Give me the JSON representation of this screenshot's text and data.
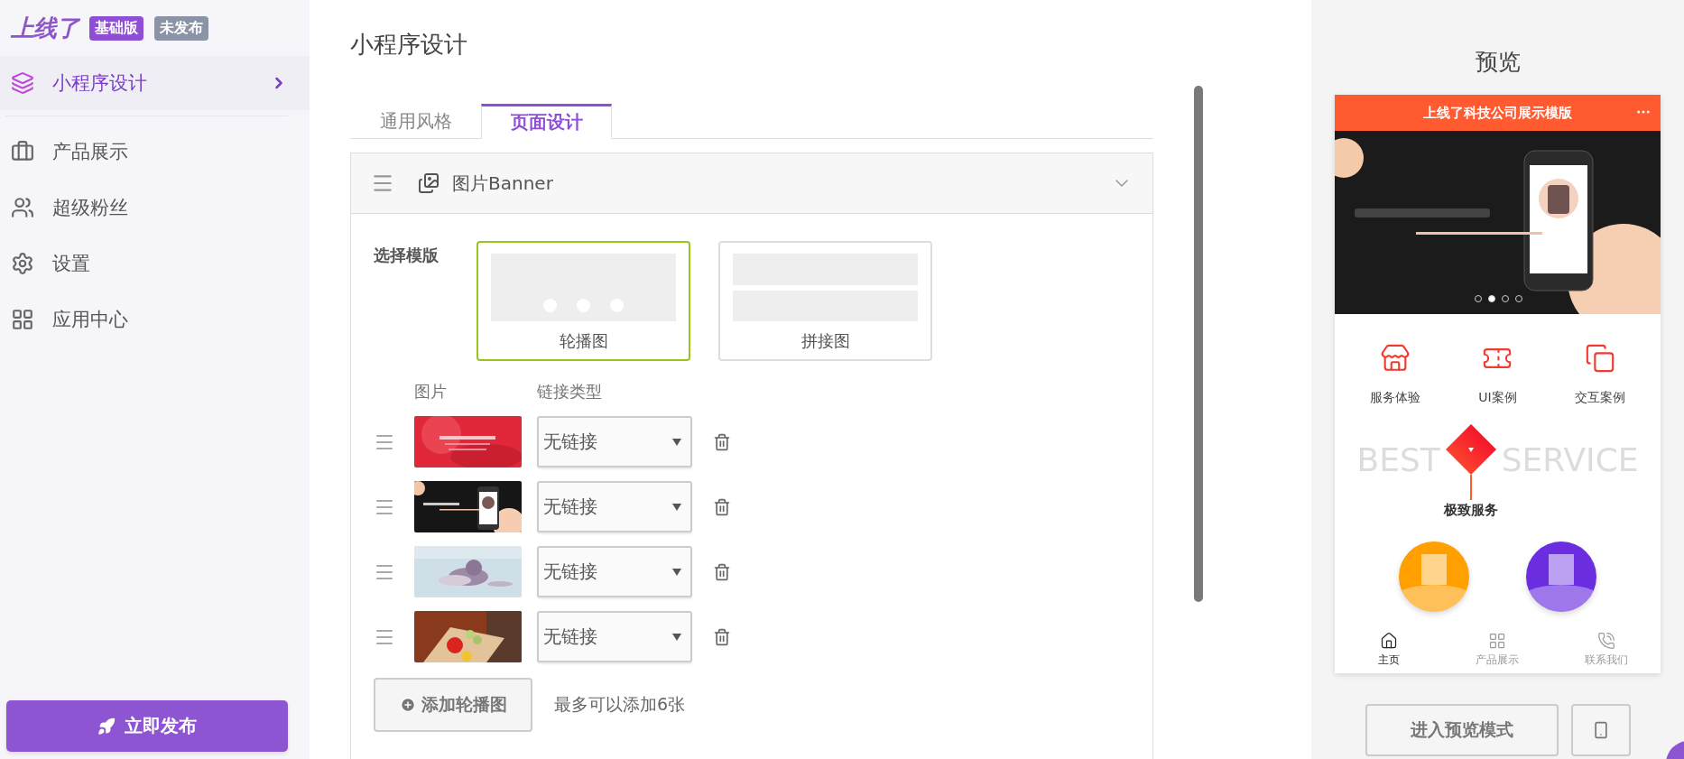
{
  "sidebar": {
    "logo": "上线了",
    "badges": [
      {
        "label": "基础版",
        "kind": "plan"
      },
      {
        "label": "未发布",
        "kind": "status"
      }
    ],
    "items": [
      {
        "label": "小程序设计",
        "kind": "layers",
        "selected": true
      },
      {
        "label": "产品展示",
        "kind": "briefcase",
        "selected": false
      },
      {
        "label": "超级粉丝",
        "kind": "users",
        "selected": false
      },
      {
        "label": "设置",
        "kind": "settings",
        "selected": false
      },
      {
        "label": "应用中心",
        "kind": "apps",
        "selected": false
      }
    ],
    "publish_button": "立即发布"
  },
  "main": {
    "title": "小程序设计",
    "tabs": [
      {
        "label": "通用风格",
        "selected": false
      },
      {
        "label": "页面设计",
        "selected": true
      }
    ],
    "module": {
      "title": "图片Banner",
      "expanded": true,
      "template_label": "选择模版",
      "templates": [
        {
          "label": "轮播图",
          "kind": "carousel",
          "selected": true
        },
        {
          "label": "拼接图",
          "kind": "collage",
          "selected": false
        }
      ],
      "columns": [
        "图片",
        "链接类型"
      ],
      "rows": [
        {
          "link_type": "无链接"
        },
        {
          "link_type": "无链接"
        },
        {
          "link_type": "无链接"
        },
        {
          "link_type": "无链接"
        }
      ],
      "add_button": "添加轮播图",
      "hint": "最多可以添加6张"
    }
  },
  "preview": {
    "title": "预览",
    "phone": {
      "header": "上线了科技公司展示模版",
      "banner_dots": [
        {
          "selected": false
        },
        {
          "selected": true
        },
        {
          "selected": false
        },
        {
          "selected": false
        }
      ],
      "shortcuts": [
        {
          "label": "服务体验",
          "kind": "store"
        },
        {
          "label": "UI案例",
          "kind": "ticket"
        },
        {
          "label": "交互案例",
          "kind": "stack"
        }
      ],
      "watermark": [
        "BEST",
        "SERVICE"
      ],
      "section_title": "极致服务",
      "features": [
        {
          "color": "#ff9f00"
        },
        {
          "color": "#6a2ee0"
        }
      ],
      "tabbar": [
        {
          "label": "主页",
          "kind": "home",
          "selected": true
        },
        {
          "label": "产品展示",
          "kind": "grid",
          "selected": false
        },
        {
          "label": "联系我们",
          "kind": "phone",
          "selected": false
        }
      ]
    },
    "preview_button": "进入预览模式"
  }
}
